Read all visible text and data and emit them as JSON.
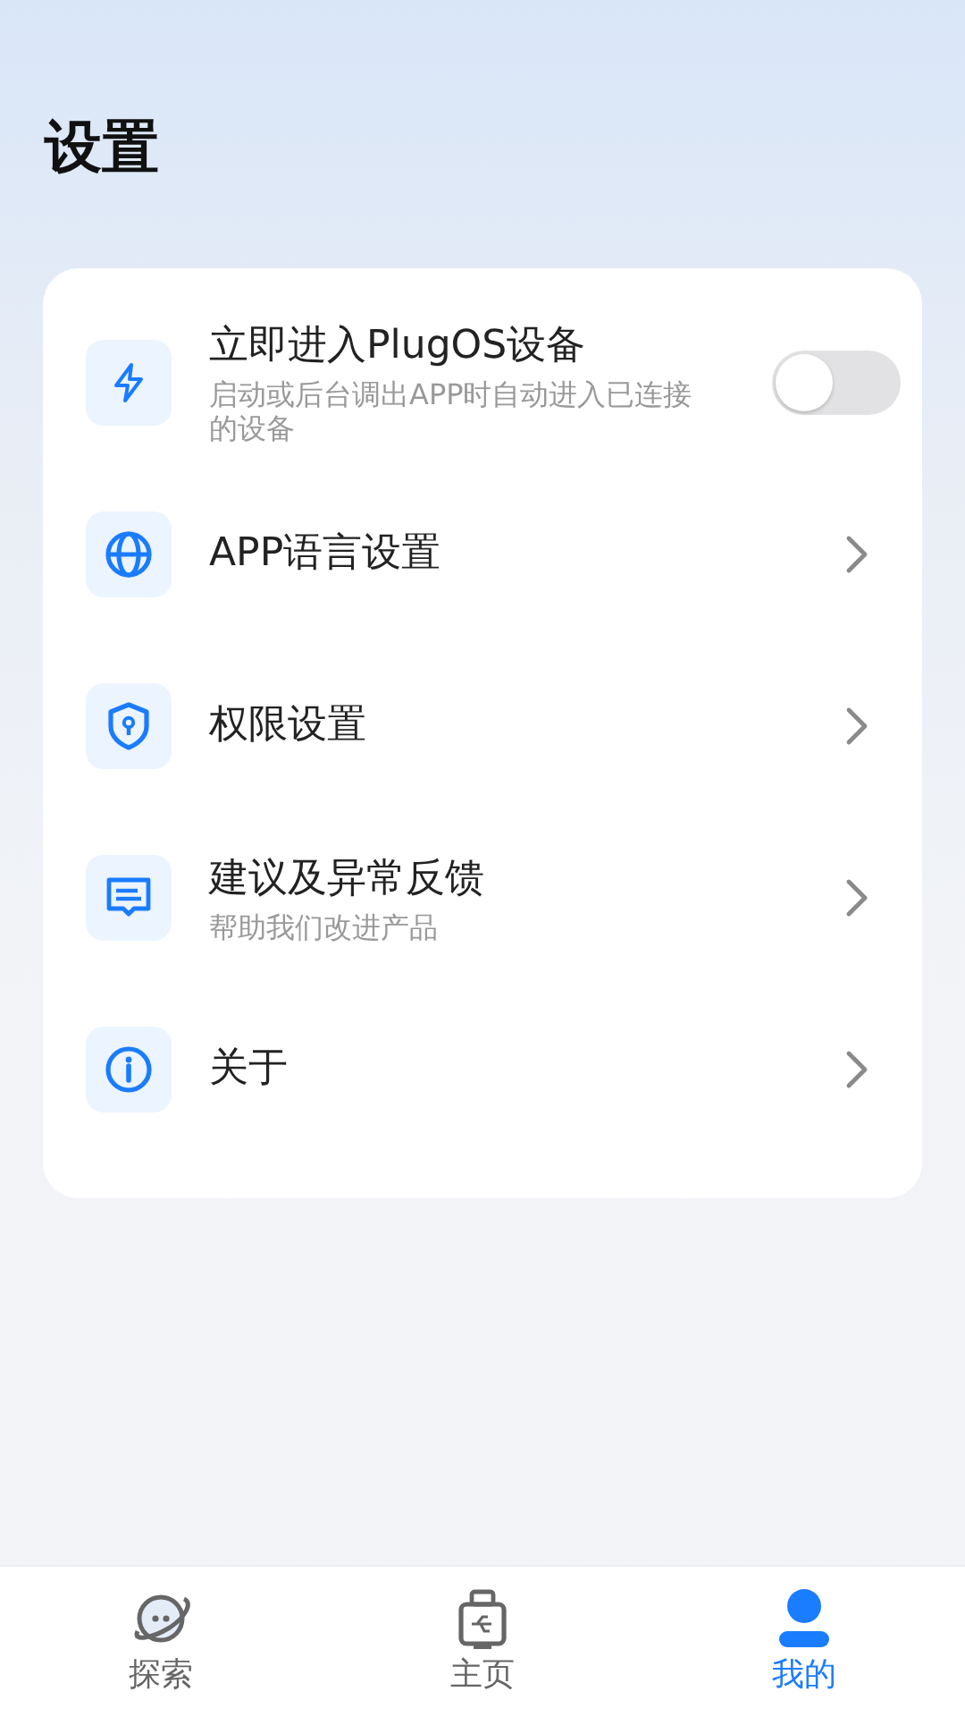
{
  "title": "设置",
  "settings": [
    {
      "kind": "toggle",
      "label": "立即进入PlugOS设备",
      "subtitle": "启动或后台调出APP时自动进入已连接的设备",
      "on": false
    },
    {
      "kind": "link",
      "label": "APP语言设置"
    },
    {
      "kind": "link",
      "label": "权限设置"
    },
    {
      "kind": "link",
      "label": "建议及异常反馈",
      "subtitle": "帮助我们改进产品"
    },
    {
      "kind": "link",
      "label": "关于"
    }
  ],
  "tabs": [
    {
      "label": "探索",
      "selected": false
    },
    {
      "label": "主页",
      "selected": false
    },
    {
      "label": "我的",
      "selected": true
    }
  ]
}
